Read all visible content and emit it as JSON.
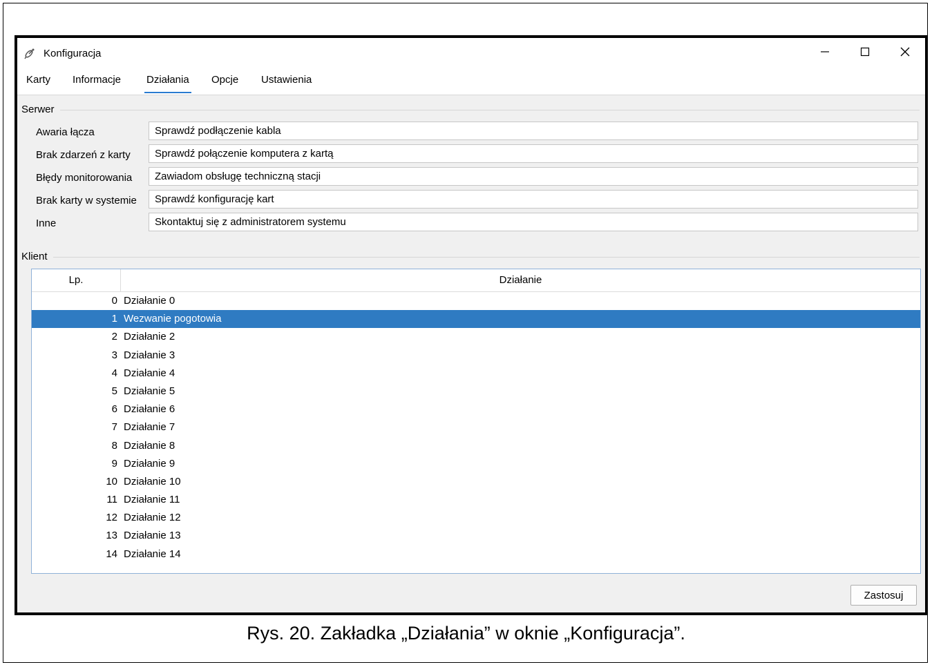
{
  "window": {
    "title": "Konfiguracja",
    "minimize_glyph": "—",
    "maximize_glyph": "☐",
    "close_glyph": "✕"
  },
  "tabs": [
    {
      "label": "Karty",
      "active": false
    },
    {
      "label": "Informacje",
      "active": false
    },
    {
      "label": "Działania",
      "active": true
    },
    {
      "label": "Opcje",
      "active": false
    },
    {
      "label": "Ustawienia",
      "active": false
    }
  ],
  "server": {
    "section_label": "Serwer",
    "rows": [
      {
        "label": "Awaria łącza",
        "value": "Sprawdź podłączenie kabla"
      },
      {
        "label": "Brak zdarzeń z karty",
        "value": "Sprawdź połączenie komputera z kartą"
      },
      {
        "label": "Błędy monitorowania",
        "value": "Zawiadom obsługę techniczną stacji"
      },
      {
        "label": "Brak karty w systemie",
        "value": "Sprawdź konfigurację kart"
      },
      {
        "label": "Inne",
        "value": "Skontaktuj się z administratorem systemu"
      }
    ]
  },
  "client": {
    "section_label": "Klient",
    "columns": [
      "Lp.",
      "Działanie"
    ],
    "selected_index": 1,
    "rows": [
      {
        "lp": "0",
        "action": "Działanie 0"
      },
      {
        "lp": "1",
        "action": "Wezwanie pogotowia"
      },
      {
        "lp": "2",
        "action": "Działanie 2"
      },
      {
        "lp": "3",
        "action": "Działanie 3"
      },
      {
        "lp": "4",
        "action": "Działanie 4"
      },
      {
        "lp": "5",
        "action": "Działanie 5"
      },
      {
        "lp": "6",
        "action": "Działanie 6"
      },
      {
        "lp": "7",
        "action": "Działanie 7"
      },
      {
        "lp": "8",
        "action": "Działanie 8"
      },
      {
        "lp": "9",
        "action": "Działanie 9"
      },
      {
        "lp": "10",
        "action": "Działanie 10"
      },
      {
        "lp": "11",
        "action": "Działanie 11"
      },
      {
        "lp": "12",
        "action": "Działanie 12"
      },
      {
        "lp": "13",
        "action": "Działanie 13"
      },
      {
        "lp": "14",
        "action": "Działanie 14"
      }
    ]
  },
  "buttons": {
    "apply_label": "Zastosuj"
  },
  "caption": "Rys. 20. Zakładka „Działania” w oknie „Konfiguracja”.",
  "icons": {
    "app": "satellite-dish-icon"
  },
  "colors": {
    "selection": "#2f7bc2",
    "active_tab_underline": "#2a7bd0"
  }
}
